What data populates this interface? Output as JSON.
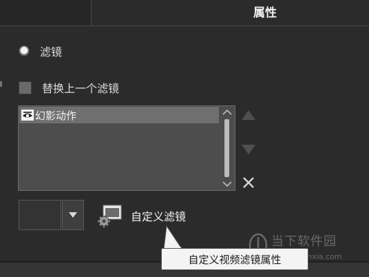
{
  "panel": {
    "title": "属性"
  },
  "filter_option": {
    "label": "滤镜",
    "selected": true
  },
  "replace_option": {
    "label": "替换上一个滤镜",
    "checked": false
  },
  "filter_list": {
    "items": [
      {
        "label": "幻影动作",
        "icon": "eye-icon"
      }
    ]
  },
  "controls": {
    "custom_filter_label": "自定义滤镜"
  },
  "tooltip": {
    "text": "自定义视频滤镜属性"
  },
  "watermark": {
    "name": "当下软件园",
    "url": "www.downxia.com"
  },
  "colors": {
    "background": "#2b2b2b",
    "list_bg": "#4d4d4d",
    "selected_row": "#6f6f6f"
  }
}
